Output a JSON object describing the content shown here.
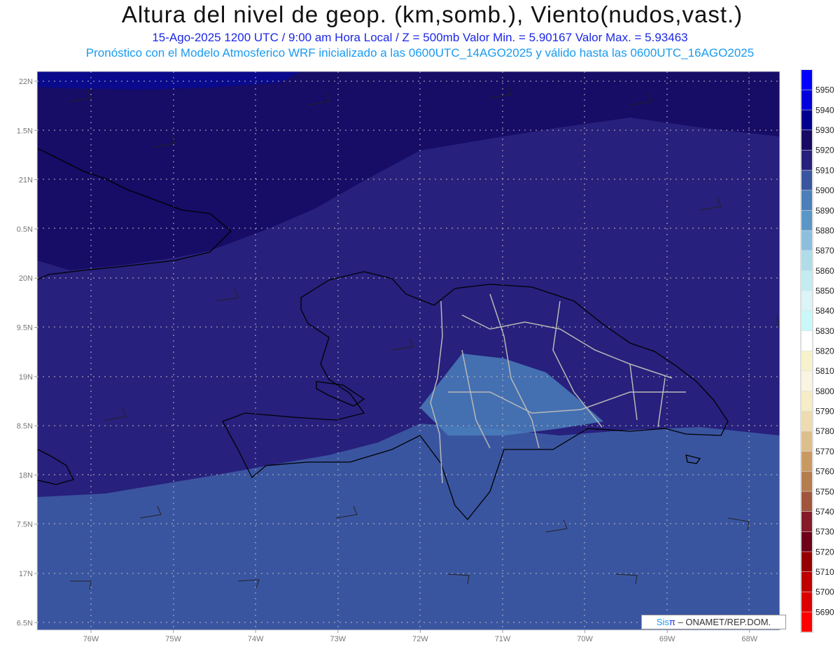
{
  "header": {
    "title": "Altura del nivel de geop. (km,somb.), Viento(nudos,vast.)",
    "line1": "15-Ago-2025   1200 UTC / 9:00 am Hora Local / Z = 500mb     Valor Min. = 5.90167   Valor Max. = 5.93463",
    "line2": "Pronóstico con el Modelo Atmosferico WRF inicializado a las 0600UTC_14AGO2025 y válido hasta las  0600UTC_16AGO2025"
  },
  "map": {
    "y_labels": [
      "22N",
      "1.5N",
      "21N",
      "0.5N",
      "20N",
      "9.5N",
      "19N",
      "8.5N",
      "18N",
      "7.5N",
      "17N",
      "6.5N"
    ],
    "x_labels": [
      "76W",
      "75W",
      "74W",
      "73W",
      "72W",
      "71W",
      "70W",
      "69W",
      "68W"
    ],
    "fill_colors": {
      "c5930": "#0a0a8c",
      "c5920": "#170c66",
      "c5910": "#27207c",
      "c5900": "#3a55a0",
      "c5890": "#4a7fbb"
    }
  },
  "colorbar": {
    "labels": [
      "5950",
      "5940",
      "5930",
      "5920",
      "5910",
      "5900",
      "5890",
      "5880",
      "5870",
      "5860",
      "5850",
      "5840",
      "5830",
      "5820",
      "5810",
      "5800",
      "5790",
      "5780",
      "5770",
      "5760",
      "5750",
      "5740",
      "5730",
      "5720",
      "5710",
      "5700",
      "5690"
    ],
    "colors": [
      "#0000ff",
      "#0000dd",
      "#00008f",
      "#170a64",
      "#27207c",
      "#3a55a0",
      "#4a7fbb",
      "#5a96c6",
      "#8cbfdd",
      "#b0dcea",
      "#c2ecf2",
      "#dbf4f8",
      "#c9f8fa",
      "#ffffff",
      "#f8f2cc",
      "#faf4e2",
      "#f6ecc6",
      "#eedcb0",
      "#dcbf8a",
      "#c89a62",
      "#b57c4e",
      "#a0553c",
      "#861a28",
      "#6e0019",
      "#960000",
      "#be0000",
      "#dd0000",
      "#ff0000"
    ]
  },
  "credit": {
    "sis": "Sis",
    "pi": "π",
    "rest": " – ONAMET/REP.DOM."
  }
}
